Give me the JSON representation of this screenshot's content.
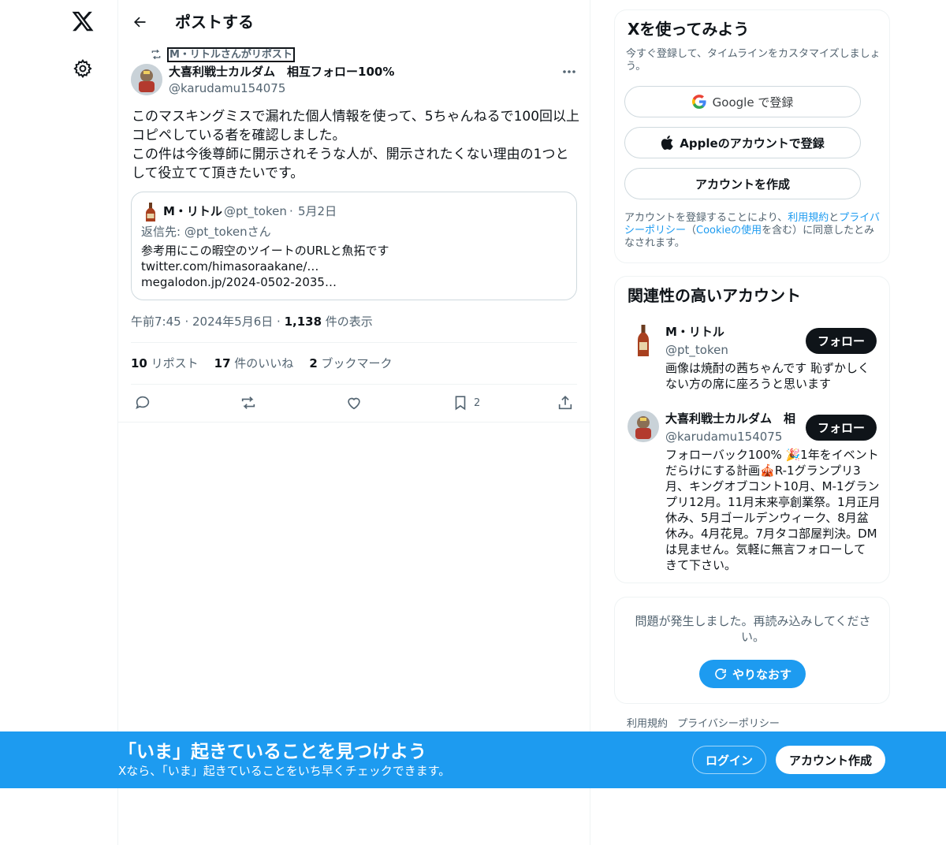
{
  "nav": {
    "logo_icon": "x-logo-icon",
    "settings_icon": "gear-icon"
  },
  "header": {
    "title": "ポストする"
  },
  "post": {
    "reposted_by": "M・リトルさんがリポスト",
    "author_name": "大喜利戦士カルダム　相互フォロー100%",
    "author_handle": "@karudamu154075",
    "text": "このマスキングミスで漏れた個人情報を使って、5ちゃんねるで100回以上\nコピペしている者を確認しました。\nこの件は今後尊師に開示されそうな人が、開示されたくない理由の1つと\nして役立てて頂きたいです。",
    "quote": {
      "name": "M・リトル",
      "handle": "@pt_token",
      "dot": "·",
      "date": "5月2日",
      "reply_to": "返信先: @pt_tokenさん",
      "text": "参考用にこの暇空のツイートのURLと魚拓です\ntwitter.com/himasoraakane/…\nmegalodon.jp/2024-0502-2035…"
    },
    "time": "午前7:45",
    "sep1": " · ",
    "date": "2024年5月6日",
    "sep2": " · ",
    "views_count": "1,138",
    "views_label": " 件の表示",
    "stats": {
      "reposts_count": "10",
      "reposts_label": " リポスト",
      "likes_count": "17",
      "likes_label": " 件のいいね",
      "bookmarks_count": "2",
      "bookmarks_label": " ブックマーク"
    },
    "actions": {
      "bookmark_count": "2"
    }
  },
  "signup_card": {
    "title": "Xを使ってみよう",
    "subtitle": "今すぐ登録して、タイムラインをカスタマイズしましょう。",
    "google_label": "Google で登録",
    "apple_label": "Appleのアカウントで登録",
    "create_label": "アカウントを作成",
    "terms_prefix": "アカウントを登録することにより、",
    "terms_link": "利用規約",
    "terms_and": "と",
    "privacy_link": "プライバシーポリシー",
    "terms_paren_open": "（",
    "cookie_link": "Cookieの使用",
    "terms_suffix": "を含む）に同意したとみなされます。"
  },
  "related": {
    "title": "関連性の高いアカウント",
    "accounts": [
      {
        "name": "M・リトル",
        "handle": "@pt_token",
        "bio": "画像は焼酎の茜ちゃんです 恥ずかしく\nない方の席に座ろうと思います",
        "follow_label": "フォロー"
      },
      {
        "name": "大喜利戦士カルダム　相",
        "handle": "@karudamu154075",
        "bio": "フォローバック100% 🎉1年をイベント\nだらけにする計画🎪R-1グランプリ3\n月、キングオブコント10月、M-1グラン\nプリ12月。11月末来亭創業祭。1月正月\n休み、5月ゴールデンウィーク、8月盆\n休み。4月花見。7月タコ部屋判決。DM\nは見ません。気軽に無言フォローして\nきて下さい。",
        "follow_label": "フォロー"
      }
    ]
  },
  "error_card": {
    "message": "問題が発生しました。再読み込みしてください。",
    "retry_label": "やりなおす"
  },
  "footer": {
    "links": "利用規約 プライバシーポリシー"
  },
  "banner": {
    "title": "「いま」起きていることを見つけよう",
    "subtitle": "Xなら、「いま」起きていることをいち早くチェックできます。",
    "login_label": "ログイン",
    "signup_label": "アカウント作成"
  },
  "colors": {
    "accent": "#1d9bf0",
    "text": "#0f1419",
    "muted": "#536471",
    "border": "#eff3f4"
  }
}
